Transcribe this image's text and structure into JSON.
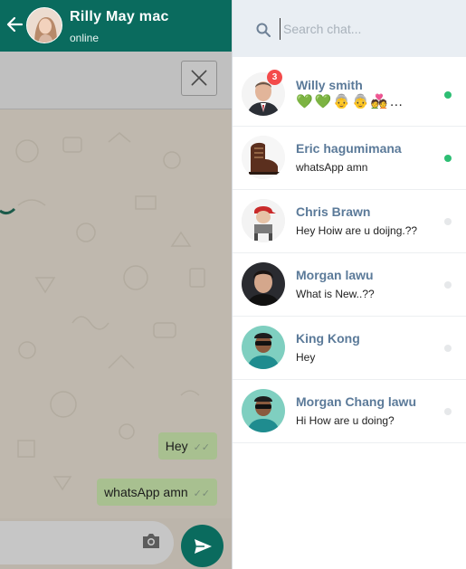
{
  "chat_window": {
    "contact_name": "Rilly May mac",
    "contact_status": "online",
    "messages": [
      {
        "text": "Hey",
        "status": "✓✓"
      },
      {
        "text": "whatsApp amn",
        "status": "✓✓"
      }
    ]
  },
  "drawer": {
    "search": {
      "placeholder": "Search chat..."
    },
    "chats": [
      {
        "name": "Willy smith",
        "preview": "💚💚👵👵💑…",
        "unread": "3",
        "online": true,
        "avatar": "man-suit"
      },
      {
        "name": "Eric hagumimana",
        "preview": "whatsApp amn",
        "online": true,
        "avatar": "boot"
      },
      {
        "name": "Chris Brawn",
        "preview": "Hey Hoiw are u doijng.??",
        "online": false,
        "avatar": "kid-cap"
      },
      {
        "name": "Morgan lawu",
        "preview": "What is New..??",
        "online": false,
        "avatar": "man-dark"
      },
      {
        "name": "King Kong",
        "preview": "Hey",
        "online": false,
        "avatar": "boy-sunglasses"
      },
      {
        "name": "Morgan Chang lawu",
        "preview": "Hi How are u doing?",
        "online": false,
        "avatar": "boy-sunglasses"
      }
    ]
  },
  "colors": {
    "header": "#0a6b5e",
    "name": "#5b7a99",
    "online": "#2dbe73",
    "badge": "#f44b4b"
  }
}
